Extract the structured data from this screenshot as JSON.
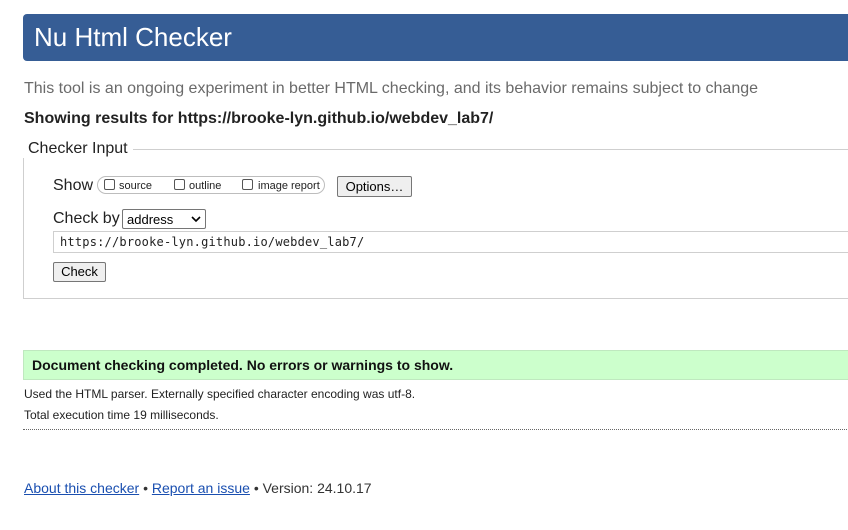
{
  "header": {
    "title": "Nu Html Checker"
  },
  "tagline": "This tool is an ongoing experiment in better HTML checking, and its behavior remains subject to change",
  "showing_results": "Showing results for https://brooke-lyn.github.io/webdev_lab7/",
  "checker_input": {
    "legend": "Checker Input",
    "show_label": "Show",
    "show_options": [
      {
        "label": "source",
        "checked": false
      },
      {
        "label": "outline",
        "checked": false
      },
      {
        "label": "image report",
        "checked": false
      }
    ],
    "options_button": "Options…",
    "check_by_label": "Check by",
    "check_by_selected": "address",
    "url_value": "https://brooke-lyn.github.io/webdev_lab7/",
    "check_button": "Check"
  },
  "result": {
    "success_message": "Document checking completed. No errors or warnings to show.",
    "parser_info": "Used the HTML parser. Externally specified character encoding was utf-8.",
    "execution_time": "Total execution time 19 milliseconds."
  },
  "footer": {
    "about_link": "About this checker",
    "separator": "•",
    "report_link": "Report an issue",
    "version_text": "Version: 24.10.17"
  },
  "colors": {
    "header_bg": "#365d95",
    "success_bg": "#ccffcc",
    "link": "#1a4fb0"
  }
}
